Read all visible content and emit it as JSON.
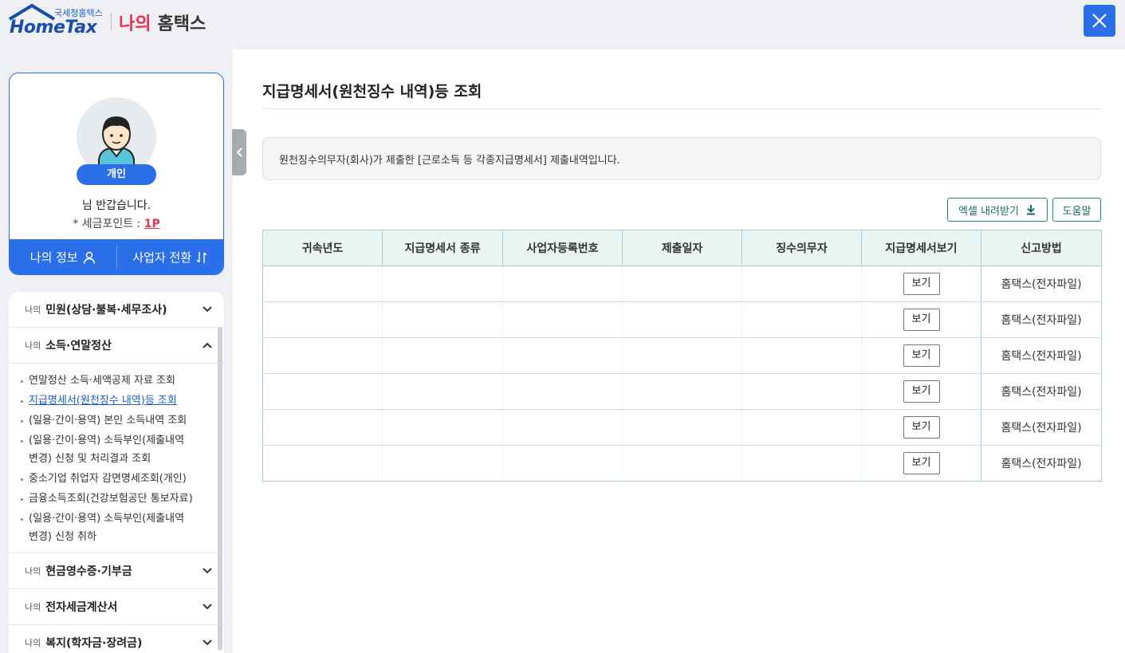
{
  "header": {
    "logo_sub": "국세청홈택스",
    "logo_main": "HomeTax",
    "my_prefix": "나의",
    "my_title": "홈택스"
  },
  "profile": {
    "badge": "개인",
    "greeting": "님 반갑습니다.",
    "points_label": "* 세금포인트 : ",
    "points_value": "1P",
    "my_info_button": "나의 정보",
    "switch_business_button": "사업자 전환"
  },
  "menu": {
    "prefix": "나의",
    "sections": [
      {
        "title": "민원(상담·불복·세무조사)"
      },
      {
        "title": "소득·연말정산"
      },
      {
        "title": "현금영수증·기부금"
      },
      {
        "title": "전자세금계산서"
      },
      {
        "title": "복지(학자금·장려금)"
      }
    ],
    "sub_items": [
      {
        "line1": "연말정산 소득·세액공제 자료 조회",
        "line2": ""
      },
      {
        "line1": "지급명세서(원천징수 내역)등 조회",
        "line2": ""
      },
      {
        "line1": "(일용·간이·용역) 본인 소득내역 조회",
        "line2": ""
      },
      {
        "line1": "(일용·간이·용역) 소득부인(제출내역",
        "line2": "변경) 신청 및 처리결과 조회"
      },
      {
        "line1": "중소기업 취업자 감면명세조회(개인)",
        "line2": ""
      },
      {
        "line1": "금융소득조회(건강보험공단 통보자료)",
        "line2": ""
      },
      {
        "line1": "(일용·간이·용역) 소득부인(제출내역",
        "line2": "변경) 신청 취하"
      }
    ]
  },
  "main": {
    "title": "지급명세서(원천징수 내역)등 조회",
    "info": "원천징수의무자(회사)가 제출한 [근로소득 등 각종지급명세서] 제출내역입니다.",
    "excel_button": "엑셀 내려받기",
    "help_button": "도움말",
    "table": {
      "headers": [
        "귀속년도",
        "지급명세서 종류",
        "사업자등록번호",
        "제출일자",
        "징수의무자",
        "지급명세서보기",
        "신고방법"
      ],
      "rows": [
        {
          "view": "보기",
          "method": "홈택스(전자파일)"
        },
        {
          "view": "보기",
          "method": "홈택스(전자파일)"
        },
        {
          "view": "보기",
          "method": "홈택스(전자파일)"
        },
        {
          "view": "보기",
          "method": "홈택스(전자파일)"
        },
        {
          "view": "보기",
          "method": "홈택스(전자파일)"
        },
        {
          "view": "보기",
          "method": "홈택스(전자파일)"
        }
      ]
    }
  },
  "colors": {
    "accent": "#2a6ee8",
    "brand_red": "#e8324f",
    "teal": "#1c8a7e"
  },
  "icons": [
    "close-icon",
    "user-icon",
    "switch-icon",
    "chevron-down-icon",
    "chevron-up-icon",
    "download-icon",
    "chevron-left-icon"
  ]
}
